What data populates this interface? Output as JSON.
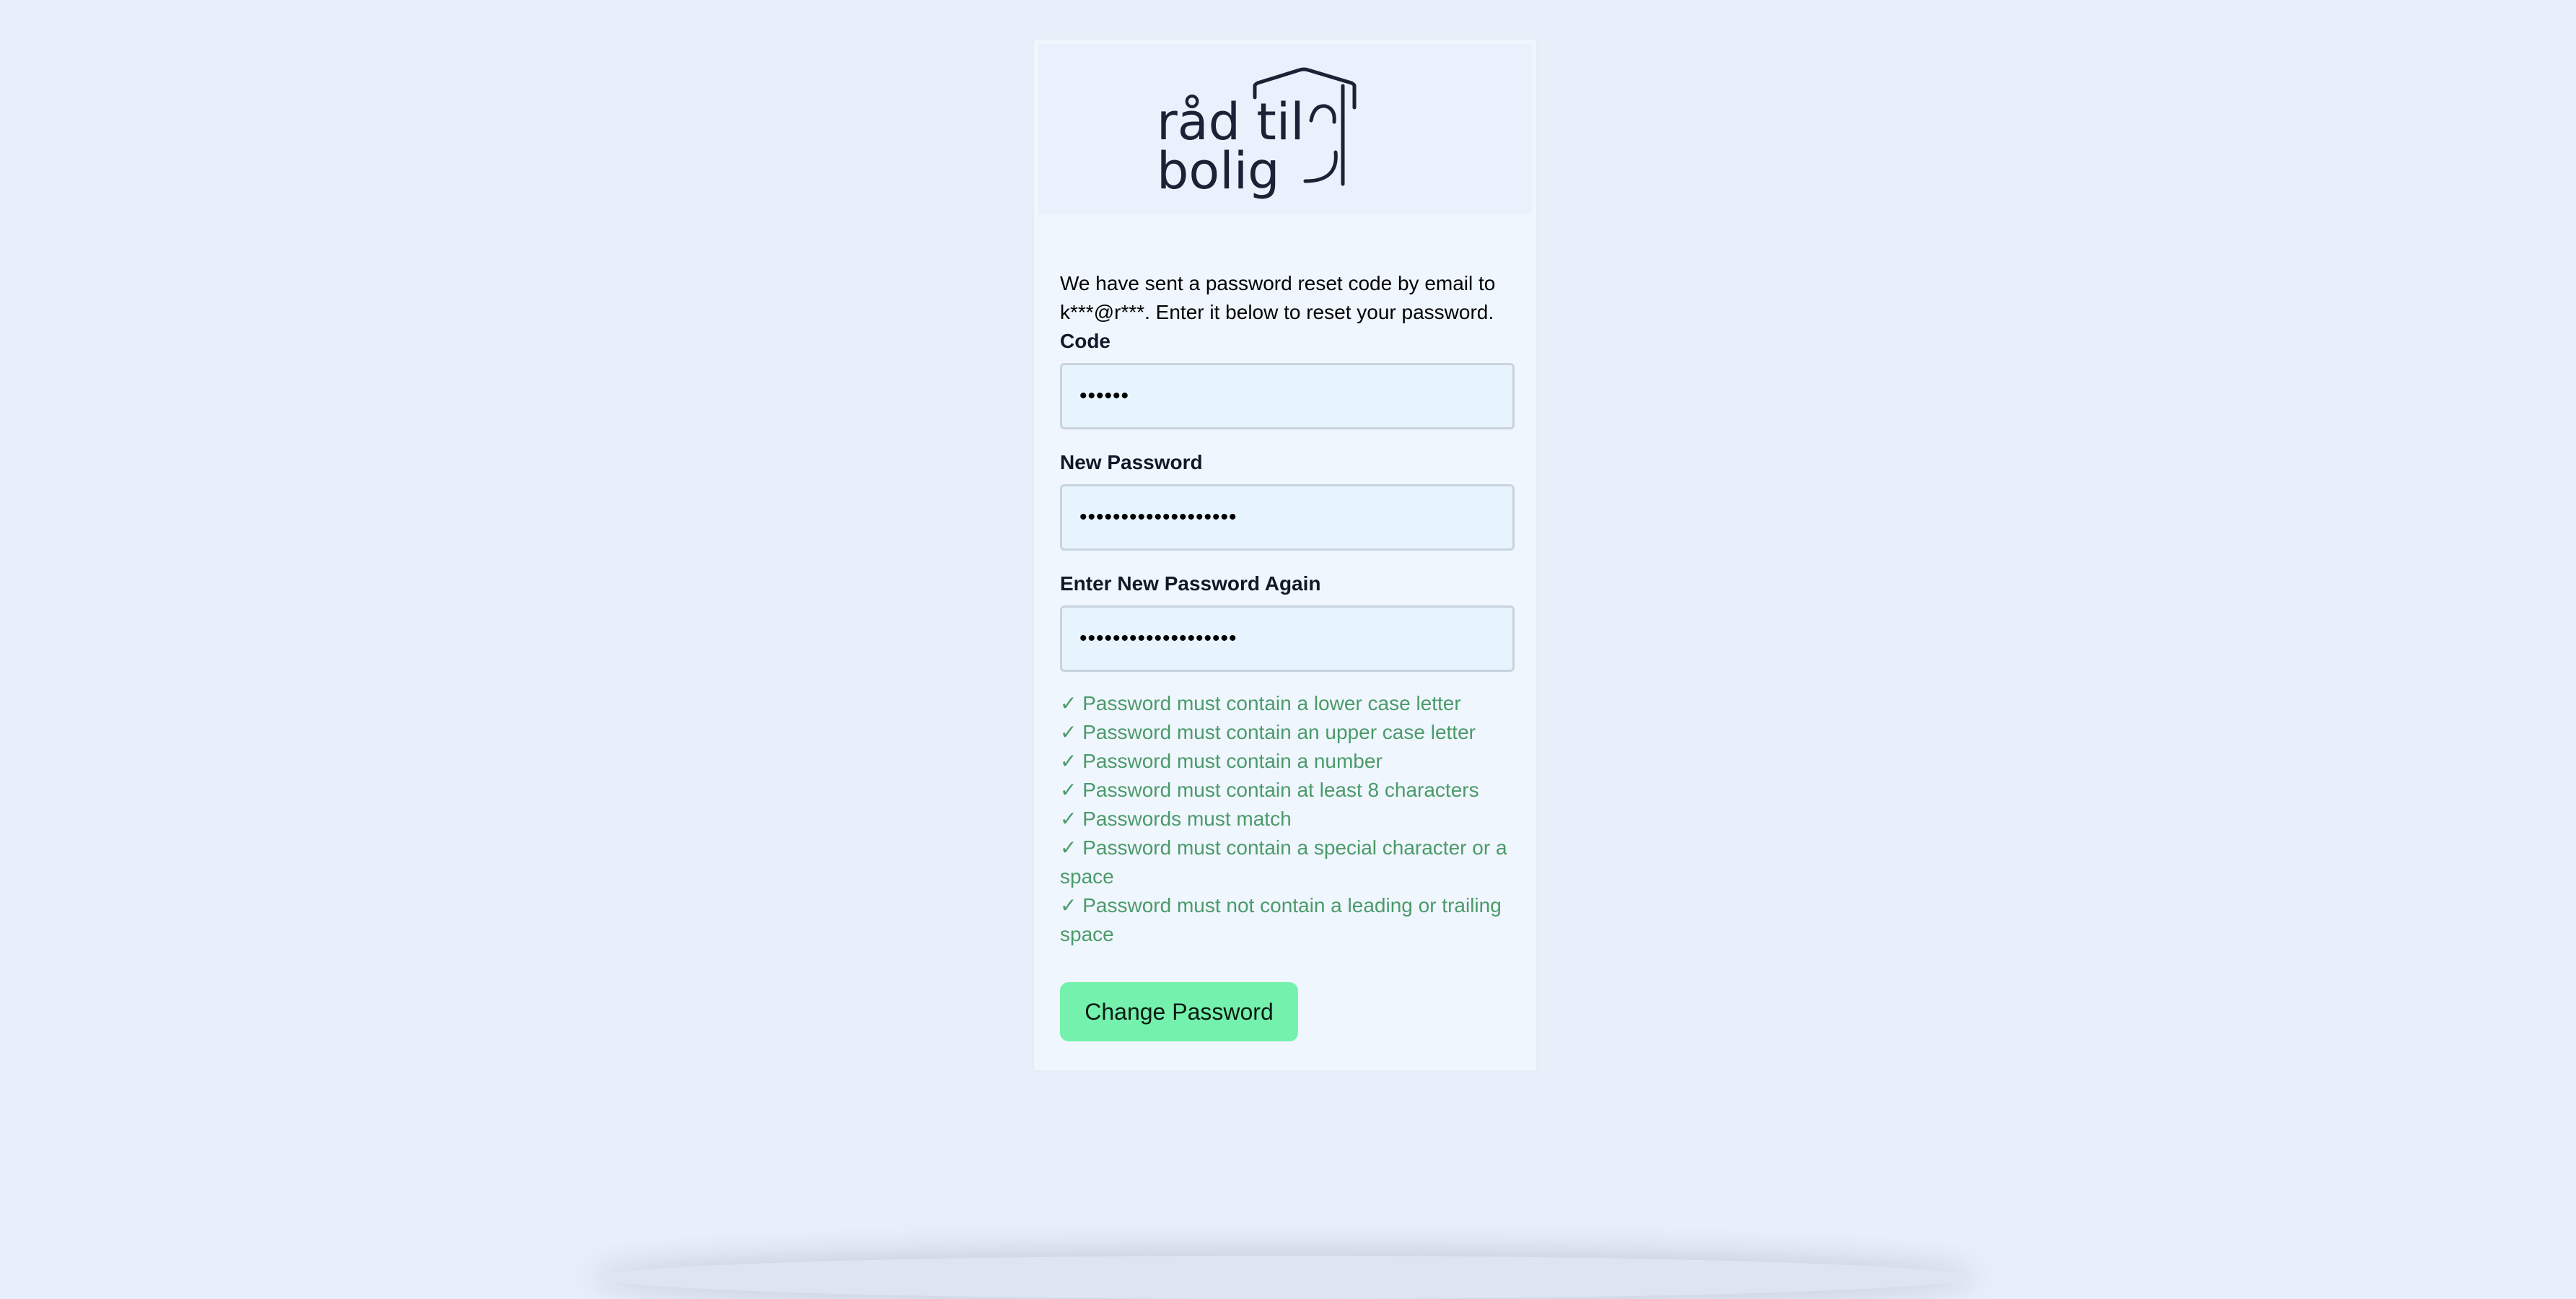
{
  "brand": {
    "logo_line1": "råd til",
    "logo_line2": "bolig"
  },
  "reset": {
    "message": "We have sent a password reset code by email to k***@r***. Enter it below to reset your password.",
    "code_label": "Code",
    "code_value": "••••••",
    "new_password_label": "New Password",
    "new_password_value": "•••••••••••••••••••",
    "confirm_password_label": "Enter New Password Again",
    "confirm_password_value": "•••••••••••••••••••",
    "rules": [
      "✓ Password must contain a lower case letter",
      "✓ Password must contain an upper case letter",
      "✓ Password must contain a number",
      "✓ Password must contain at least 8 characters",
      "✓ Passwords must match",
      "✓ Password must contain a special character or a space",
      "✓ Password must not contain a leading or trailing space"
    ],
    "submit_label": "Change Password"
  },
  "colors": {
    "background": "#e8eefa",
    "card": "#eff6fd",
    "rule_ok": "#4b9a6a",
    "button": "#74f1ad"
  }
}
